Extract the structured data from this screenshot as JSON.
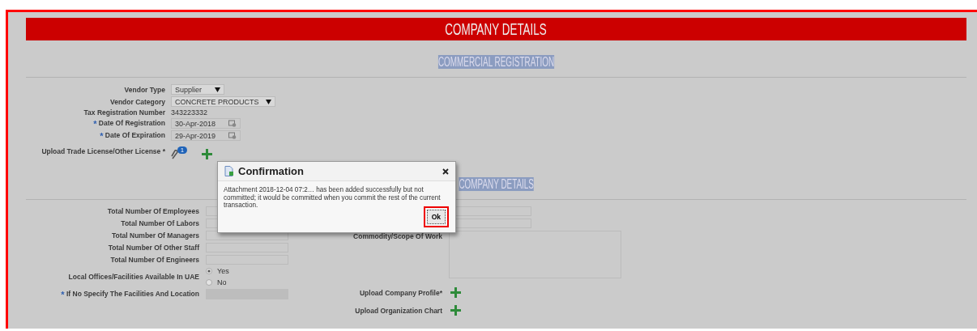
{
  "header": {
    "title": "COMPANY DETAILS"
  },
  "commercial_registration": {
    "title": "COMMERCIAL REGISTRATION",
    "fields": [
      {
        "kind": "select",
        "label": "Vendor Type",
        "value": "Supplier"
      },
      {
        "kind": "select",
        "label": "Vendor Category",
        "value": "CONCRETE PRODUCTS"
      },
      {
        "kind": "text",
        "label": "Tax Registration Number",
        "value": "343223332"
      },
      {
        "kind": "date",
        "label": "Date Of Registration",
        "value": "30-Apr-2018",
        "required_marker": "*"
      },
      {
        "kind": "date",
        "label": "Date Of Expiration",
        "value": "29-Apr-2019",
        "required_marker": "*"
      },
      {
        "kind": "upload",
        "label": "Upload Trade License/Other License *",
        "count": "1"
      }
    ]
  },
  "company_details": {
    "title": "COMPANY DETAILS",
    "left_fields": [
      {
        "kind": "input",
        "label": "Total Number Of Employees",
        "disabled": false
      },
      {
        "kind": "input",
        "label": "Total Number Of Labors",
        "disabled": false
      },
      {
        "kind": "input",
        "label": "Total Number Of Managers",
        "disabled": false
      },
      {
        "kind": "input",
        "label": "Total Number Of Other Staff",
        "disabled": false
      },
      {
        "kind": "input",
        "label": "Total Number Of Engineers",
        "disabled": false
      },
      {
        "kind": "radio",
        "label": "Local Offices/Facilities Available In UAE",
        "options": [
          {
            "label": "Yes",
            "selected": true
          },
          {
            "label": "No",
            "selected": false
          }
        ]
      },
      {
        "kind": "input",
        "label": "If No Specify The Facilities And Location",
        "required_marker": "*",
        "disabled": true
      }
    ],
    "right_fields": [
      {
        "kind": "input"
      },
      {
        "kind": "input"
      },
      {
        "kind": "textarea",
        "label": "Commodity/Scope Of Work"
      },
      {
        "kind": "upload",
        "label": "Upload Company Profile*"
      },
      {
        "kind": "upload",
        "label": "Upload Organization Chart"
      }
    ]
  },
  "dialog": {
    "title": "Confirmation",
    "message": "Attachment 2018-12-04 07:2… has been added successfully but not committed; it would be committed when you commit the rest of the current transaction.",
    "button": "Ok"
  }
}
